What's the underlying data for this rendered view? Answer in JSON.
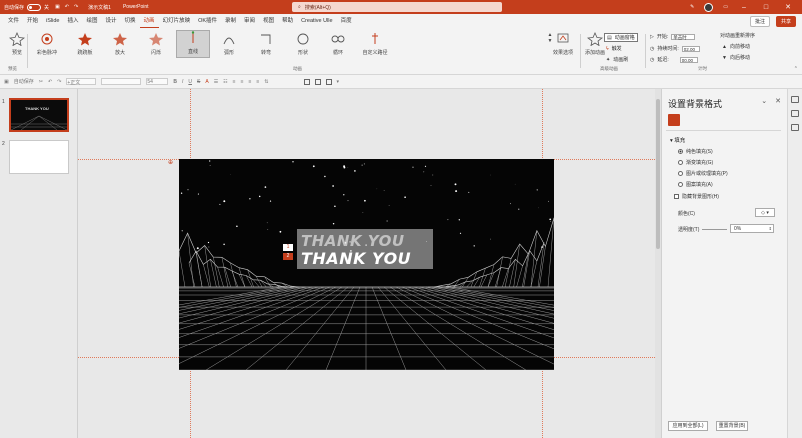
{
  "titlebar": {
    "autosave_label": "自动保存",
    "autosave_state": "关",
    "filename": "演示文稿1",
    "app": "PowerPoint",
    "search_placeholder": "搜索(Alt+Q)",
    "share_label": "共享",
    "comment_label": "批注"
  },
  "tabs": [
    "文件",
    "开始",
    "iSlide",
    "插入",
    "绘图",
    "设计",
    "切换",
    "动画",
    "幻灯片放映",
    "OK插件",
    "录制",
    "审阅",
    "视图",
    "帮助",
    "Creative Ulle",
    "百度"
  ],
  "active_tab": "动画",
  "ribbon": {
    "preview_label": "预览",
    "preview_group": "预览",
    "animations": [
      "彩色脉冲",
      "跷跷板",
      "放大",
      "闪烁",
      "直线",
      "弧形",
      "转弯",
      "形状",
      "循环",
      "自定义路径"
    ],
    "selected_animation": "直线",
    "animation_group": "动画",
    "effect_options": "效果选项",
    "add_animation": "添加动画",
    "animation_pane": "动画窗格",
    "trigger": "触发",
    "animation_painter": "动画刷",
    "advanced_group": "高级动画",
    "start_label": "开始:",
    "start_value": "单击时",
    "duration_label": "持续时间:",
    "duration_value": "02.00",
    "delay_label": "延迟:",
    "delay_value": "00.00",
    "timing_group": "计时",
    "reorder_label": "对动画重新排序",
    "move_earlier": "向前移动",
    "move_later": "向后移动"
  },
  "formatbar": {
    "font_placeholder": "+正文",
    "size_value": "54"
  },
  "thumbnails": [
    {
      "number": "1",
      "caption": "THANK YOU"
    },
    {
      "number": "2",
      "caption": ""
    }
  ],
  "slide": {
    "title_shadow": "THANK YOU",
    "title_main": "THANK YOU",
    "tag_1": "1",
    "tag_2": "2"
  },
  "pane": {
    "title": "设置背景格式",
    "fill_header": "填充",
    "options": [
      "纯色填充(S)",
      "渐变填充(G)",
      "图片或纹理填充(P)",
      "图案填充(A)"
    ],
    "selected_option": "纯色填充(S)",
    "hide_bg": "隐藏背景图形(H)",
    "color_label": "颜色(C)",
    "transparency_label": "透明度(T)",
    "transparency_value": "0%",
    "apply_all": "应用到全部(L)",
    "reset": "重置背景(B)"
  },
  "colors": {
    "accent": "#c43e1c",
    "slide_bg": "#050505"
  }
}
